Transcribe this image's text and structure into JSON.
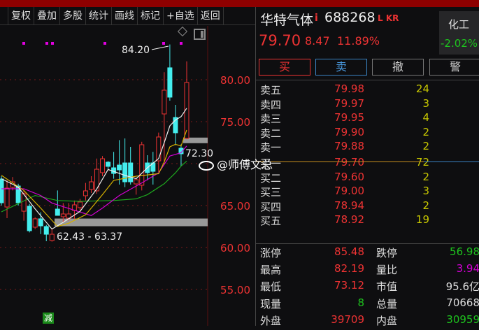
{
  "toolbar": {
    "items": [
      "复权",
      "叠加",
      "多股",
      "统计",
      "画线",
      "标记",
      "+自选",
      "返回"
    ]
  },
  "chart": {
    "y_axis_labels": [
      "80.00",
      "75.00",
      "65.00",
      "60.00",
      "55.00"
    ],
    "y_axis_values": [
      80,
      75,
      65,
      60,
      55
    ],
    "price_range": [
      52.5,
      87.5
    ],
    "high_label": "84.20",
    "zone1_label": "62.43 - 63.37",
    "zone1": [
      62.43,
      63.37
    ],
    "zone2_label": "72.30",
    "zone2": [
      72.3,
      73.1
    ],
    "signal_badge": "减",
    "watermark": "@师傅文总",
    "colors": {
      "up": "#ee3333",
      "down": "#44eeee",
      "ma5": "#eeeeee",
      "ma10": "#d4b000",
      "ma20": "#d400d4",
      "ma60": "#1ea81e"
    },
    "candles": [
      [
        68.17,
        68.5,
        65.0,
        65.33
      ],
      [
        64.83,
        68.0,
        63.5,
        67.08
      ],
      [
        67.17,
        68.4,
        66.8,
        67.83
      ],
      [
        67.33,
        67.6,
        65.0,
        65.33
      ],
      [
        64.33,
        66.8,
        63.2,
        66.42
      ],
      [
        64.92,
        65.2,
        61.8,
        62.0
      ],
      [
        62.42,
        63.6,
        62.2,
        63.42
      ],
      [
        63.42,
        64.2,
        61.6,
        62.58
      ],
      [
        62.5,
        62.7,
        60.75,
        61.58
      ],
      [
        60.83,
        62.3,
        60.7,
        61.58
      ],
      [
        64.58,
        66.8,
        63.8,
        63.83
      ],
      [
        63.67,
        65.3,
        63.0,
        64.0
      ],
      [
        63.5,
        65.3,
        63.2,
        64.0
      ],
      [
        64.42,
        65.6,
        63.4,
        65.08
      ],
      [
        64.75,
        65.8,
        64.4,
        65.42
      ],
      [
        66.17,
        67.7,
        65.6,
        66.75
      ],
      [
        66.92,
        68.5,
        66.5,
        67.83
      ],
      [
        66.75,
        70.6,
        66.4,
        69.33
      ],
      [
        68.92,
        70.9,
        68.5,
        70.58
      ],
      [
        70.17,
        70.3,
        69.3,
        69.67
      ],
      [
        69.5,
        71.4,
        68.2,
        68.83
      ],
      [
        69.83,
        72.8,
        67.5,
        69.25
      ],
      [
        70.08,
        73.0,
        67.2,
        67.83
      ],
      [
        70.08,
        72.0,
        67.5,
        67.83
      ],
      [
        67.58,
        68.3,
        66.3,
        68.08
      ],
      [
        67.42,
        72.6,
        66.8,
        72.25
      ],
      [
        70.08,
        71.0,
        68.0,
        68.92
      ],
      [
        70.08,
        71.4,
        67.5,
        69.08
      ],
      [
        70.33,
        73.7,
        69.0,
        73.17
      ],
      [
        75.92,
        80.9,
        69.9,
        78.75
      ],
      [
        81.42,
        84.2,
        77.5,
        77.92
      ],
      [
        75.5,
        77.0,
        72.2,
        73.67
      ],
      [
        71.83,
        72.3,
        69.75,
        71.17
      ],
      [
        73.0,
        82.19,
        72.9,
        79.67
      ]
    ],
    "ma5": [
      [
        0,
        68.2
      ],
      [
        3,
        67.2
      ],
      [
        6,
        64.6
      ],
      [
        9,
        62.2
      ],
      [
        11,
        63.0
      ],
      [
        14,
        64.3
      ],
      [
        17,
        67.0
      ],
      [
        19,
        69.3
      ],
      [
        22,
        68.6
      ],
      [
        24,
        68.2
      ],
      [
        26,
        69.5
      ],
      [
        28,
        70.6
      ],
      [
        29,
        72.5
      ],
      [
        30,
        74.5
      ],
      [
        31,
        75.2
      ],
      [
        32,
        75.6
      ],
      [
        33,
        76.6
      ]
    ],
    "ma10": [
      [
        0,
        68.6
      ],
      [
        4,
        66.8
      ],
      [
        7,
        64.7
      ],
      [
        10,
        62.5
      ],
      [
        12,
        62.9
      ],
      [
        15,
        63.9
      ],
      [
        18,
        66.3
      ],
      [
        20,
        68.0
      ],
      [
        24,
        68.5
      ],
      [
        28,
        68.8
      ],
      [
        29,
        70.2
      ],
      [
        30,
        72.0
      ],
      [
        31,
        72.3
      ],
      [
        32,
        72.1
      ],
      [
        33,
        74.0
      ]
    ],
    "ma20": [
      [
        0,
        67.0
      ],
      [
        4,
        67.0
      ],
      [
        7,
        66.2
      ],
      [
        9,
        65.3
      ],
      [
        16,
        63.8
      ],
      [
        18,
        64.7
      ],
      [
        21,
        66.2
      ],
      [
        25,
        67.7
      ],
      [
        28,
        68.9
      ],
      [
        30,
        70.9
      ],
      [
        32,
        71.3
      ],
      [
        33,
        72.1
      ]
    ],
    "ma60": [
      [
        0,
        64.25
      ],
      [
        6,
        66.2
      ],
      [
        10,
        65.6
      ],
      [
        14,
        65.5
      ],
      [
        20,
        65.6
      ],
      [
        24,
        65.8
      ],
      [
        26,
        66.3
      ],
      [
        29,
        67.6
      ],
      [
        31,
        68.9
      ],
      [
        32,
        69.7
      ],
      [
        33,
        70.3
      ]
    ]
  },
  "quote": {
    "name": "华特气体",
    "info": "i",
    "code": "688268",
    "tags": "L KR",
    "price": "79.70",
    "change": "8.47",
    "change_pct": "11.89%",
    "sector": {
      "name": "化工",
      "change": "-2.02%"
    },
    "buttons": [
      "买",
      "卖",
      "撤",
      "警"
    ]
  },
  "orderbook": [
    {
      "label": "卖五",
      "price": "79.98",
      "vol": "24"
    },
    {
      "label": "卖四",
      "price": "79.97",
      "vol": "3"
    },
    {
      "label": "卖三",
      "price": "79.95",
      "vol": "4"
    },
    {
      "label": "卖二",
      "price": "79.90",
      "vol": "2"
    },
    {
      "label": "卖一",
      "price": "79.88",
      "vol": "2"
    },
    {
      "label": "买一",
      "price": "79.70",
      "vol": "72"
    },
    {
      "label": "买二",
      "price": "79.60",
      "vol": "2"
    },
    {
      "label": "买三",
      "price": "79.00",
      "vol": "3"
    },
    {
      "label": "买四",
      "price": "78.94",
      "vol": "2"
    },
    {
      "label": "买五",
      "price": "78.92",
      "vol": "19"
    }
  ],
  "stats": [
    {
      "l1": "涨停",
      "v1": "85.48",
      "c1": "red",
      "l2": "跌停",
      "v2": "56.98",
      "c2": "green"
    },
    {
      "l1": "最高",
      "v1": "82.19",
      "c1": "red",
      "l2": "量比",
      "v2": "3.94",
      "c2": "mag"
    },
    {
      "l1": "最低",
      "v1": "73.12",
      "c1": "red",
      "l2": "市值",
      "v2": "95.6亿",
      "c2": "wht"
    },
    {
      "l1": "现量",
      "v1": "8",
      "c1": "green",
      "l2": "总量",
      "v2": "70668",
      "c2": "wht"
    },
    {
      "l1": "外盘",
      "v1": "39709",
      "c1": "red",
      "l2": "内盘",
      "v2": "30959",
      "c2": "green"
    }
  ]
}
